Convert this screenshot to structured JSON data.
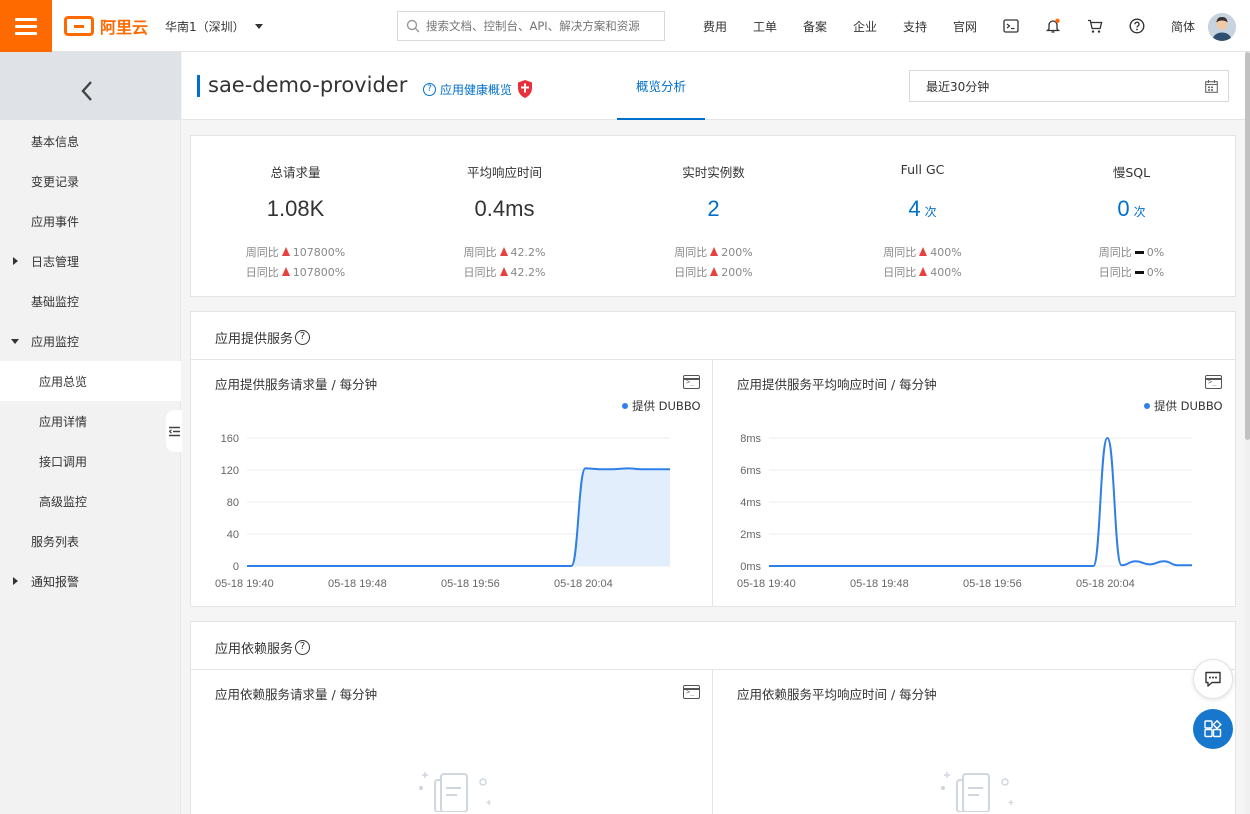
{
  "topbar": {
    "logo_text": "阿里云",
    "region": "华南1（深圳）",
    "search_placeholder": "搜索文档、控制台、API、解决方案和资源",
    "nav": [
      "费用",
      "工单",
      "备案",
      "企业",
      "支持",
      "官网"
    ],
    "lang": "简体",
    "notification_dot_color": "#ff6a00"
  },
  "sidebar": {
    "items": [
      {
        "label": "基本信息"
      },
      {
        "label": "变更记录"
      },
      {
        "label": "应用事件"
      },
      {
        "label": "日志管理"
      },
      {
        "label": "基础监控"
      },
      {
        "label": "应用监控"
      },
      {
        "label": "应用总览"
      },
      {
        "label": "应用详情"
      },
      {
        "label": "接口调用"
      },
      {
        "label": "高级监控"
      },
      {
        "label": "服务列表"
      },
      {
        "label": "通知报警"
      }
    ]
  },
  "header": {
    "title": "sae-demo-provider",
    "health_link": "应用健康概览",
    "tab": "概览分析",
    "time_range": "最近30分钟"
  },
  "stats": [
    {
      "label": "总请求量",
      "value": "1.08K",
      "unit": "",
      "wow_label": "周同比",
      "wow": "107800%",
      "dod_label": "日同比",
      "dod": "107800%"
    },
    {
      "label": "平均响应时间",
      "value": "0.4ms",
      "unit": "",
      "wow_label": "周同比",
      "wow": "42.2%",
      "dod_label": "日同比",
      "dod": "42.2%"
    },
    {
      "label": "实时实例数",
      "value": "2",
      "unit": "",
      "wow_label": "周同比",
      "wow": "200%",
      "dod_label": "日同比",
      "dod": "200%"
    },
    {
      "label": "Full GC",
      "value": "4",
      "unit": "次",
      "wow_label": "周同比",
      "wow": "400%",
      "dod_label": "日同比",
      "dod": "400%"
    },
    {
      "label": "慢SQL",
      "value": "0",
      "unit": "次",
      "wow_label": "周同比",
      "wow": "0%",
      "dod_label": "日同比",
      "dod": "0%"
    }
  ],
  "provided": {
    "section_title": "应用提供服务",
    "chart1_title": "应用提供服务请求量 / 每分钟",
    "chart2_title": "应用提供服务平均响应时间 / 每分钟",
    "legend": "提供 DUBBO"
  },
  "dependent": {
    "section_title": "应用依赖服务",
    "chart1_title": "应用依赖服务请求量 / 每分钟",
    "chart2_title": "应用依赖服务平均响应时间 / 每分钟"
  },
  "chart_data": [
    {
      "type": "area",
      "title": "应用提供服务请求量 / 每分钟",
      "x_ticks": [
        "05-18 19:40",
        "05-18 19:48",
        "05-18 19:56",
        "05-18 20:04"
      ],
      "y_ticks": [
        "0",
        "40",
        "80",
        "120",
        "160"
      ],
      "ylim": [
        0,
        160
      ],
      "series": [
        {
          "name": "提供 DUBBO",
          "color": "#2f7fe8",
          "x": [
            0,
            1,
            2,
            3,
            4,
            5,
            6,
            7,
            8,
            9,
            10,
            11,
            12,
            13,
            14,
            15,
            16,
            17,
            18,
            19,
            20,
            21,
            22,
            23,
            24,
            25,
            26,
            27,
            28,
            29,
            30
          ],
          "values": [
            0,
            0,
            0,
            0,
            0,
            0,
            0,
            0,
            0,
            0,
            0,
            0,
            0,
            0,
            0,
            0,
            0,
            0,
            0,
            0,
            0,
            0,
            0,
            0,
            122,
            121,
            121,
            122,
            121,
            121,
            121
          ]
        }
      ]
    },
    {
      "type": "line",
      "title": "应用提供服务平均响应时间 / 每分钟",
      "x_ticks": [
        "05-18 19:40",
        "05-18 19:48",
        "05-18 19:56",
        "05-18 20:04"
      ],
      "y_ticks": [
        "0ms",
        "2ms",
        "4ms",
        "6ms",
        "8ms"
      ],
      "ylim": [
        0,
        8
      ],
      "series": [
        {
          "name": "提供 DUBBO",
          "color": "#2f7fe8",
          "x": [
            0,
            1,
            2,
            3,
            4,
            5,
            6,
            7,
            8,
            9,
            10,
            11,
            12,
            13,
            14,
            15,
            16,
            17,
            18,
            19,
            20,
            21,
            22,
            23,
            24,
            25,
            26,
            27,
            28,
            29,
            30
          ],
          "values": [
            0,
            0,
            0,
            0,
            0,
            0,
            0,
            0,
            0,
            0,
            0,
            0,
            0,
            0,
            0,
            0,
            0,
            0,
            0,
            0,
            0,
            0,
            0,
            0,
            8.0,
            0.05,
            0.3,
            0.1,
            0.3,
            0.05,
            0.05
          ]
        }
      ]
    }
  ]
}
